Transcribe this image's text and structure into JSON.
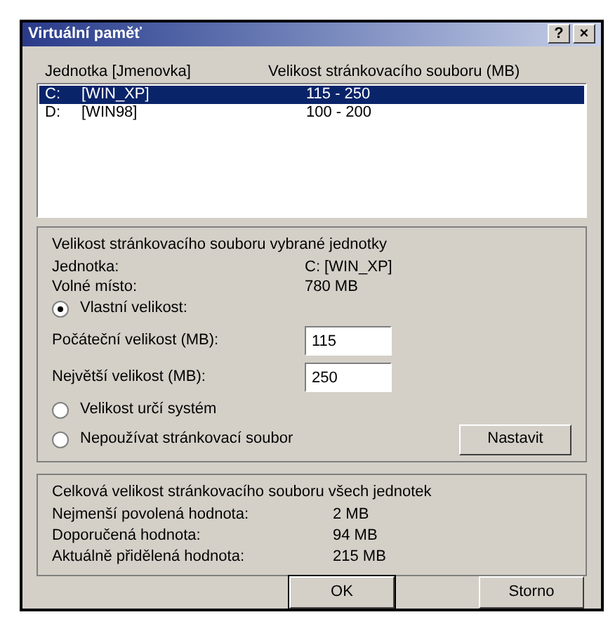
{
  "window": {
    "title": "Virtuální paměť",
    "help": "?",
    "close": "×"
  },
  "drives": {
    "columns": [
      "Jednotka [Jmenovka]",
      "Velikost stránkovacího souboru (MB)"
    ],
    "rows": [
      {
        "drive": "C:",
        "label": "[WIN_XP]",
        "size": "115 - 250",
        "selected": true
      },
      {
        "drive": "D:",
        "label": "[WIN98]",
        "size": "100 - 200",
        "selected": false
      }
    ]
  },
  "selected_drive": {
    "title": "Velikost stránkovacího souboru vybrané jednotky",
    "info": [
      {
        "label": "Jednotka:",
        "value": "C: [WIN_XP]"
      },
      {
        "label": "Volné místo:",
        "value": "780 MB"
      }
    ],
    "options": [
      {
        "label": "Vlastní velikost:",
        "selected": true
      },
      {
        "label": "Velikost určí systém",
        "selected": false
      },
      {
        "label": "Nepoužívat stránkovací soubor",
        "selected": false
      }
    ],
    "fields": [
      {
        "label": "Počáteční velikost (MB):",
        "value": "115"
      },
      {
        "label": "Největší velikost (MB):",
        "value": "250"
      }
    ],
    "set_button": "Nastavit"
  },
  "totals": {
    "title": "Celková velikost stránkovacího souboru všech jednotek",
    "rows": [
      {
        "label": "Nejmenší povolená hodnota:",
        "value": "2 MB"
      },
      {
        "label": "Doporučená hodnota:",
        "value": "94 MB"
      },
      {
        "label": "Aktuálně přidělená hodnota:",
        "value": "215 MB"
      }
    ]
  },
  "buttons": [
    "OK",
    "Storno"
  ]
}
